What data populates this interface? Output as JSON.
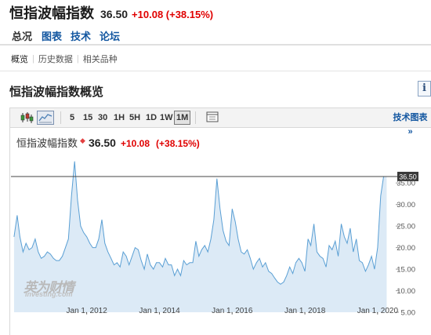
{
  "header": {
    "title": "恒指波幅指数",
    "price": "36.50",
    "change": "+10.08 (+38.15%)"
  },
  "main_tabs": [
    {
      "label": "总况",
      "active": true
    },
    {
      "label": "图表",
      "active": false
    },
    {
      "label": "技术",
      "active": false
    },
    {
      "label": "论坛",
      "active": false
    }
  ],
  "sub_tabs": [
    {
      "label": "概览",
      "active": true
    },
    {
      "label": "历史数据",
      "active": false
    },
    {
      "label": "相关品种",
      "active": false
    }
  ],
  "section": {
    "title": "恒指波幅指数概览",
    "info_icon": "i"
  },
  "toolbar": {
    "icons": [
      "candlestick-icon",
      "area-chart-icon"
    ],
    "intervals": [
      "5",
      "15",
      "30",
      "1H",
      "5H",
      "1D",
      "1W",
      "1M"
    ],
    "active_interval": "1M",
    "settings_icon": "settings-panel-icon",
    "tech_chart_label": "技术图表 »"
  },
  "legend": {
    "name": "恒指波幅指数",
    "price": "36.50",
    "change": "+10.08",
    "pct": "(+38.15%)",
    "dot_color": "#e34040"
  },
  "watermark": {
    "cn": "英为财情",
    "en": "Investing.com"
  },
  "chart_data": {
    "type": "area",
    "title": "",
    "xlabel": "",
    "ylabel": "",
    "y_ticks": [
      "5.00",
      "10.00",
      "15.00",
      "20.00",
      "25.00",
      "30.00",
      "35.00"
    ],
    "ylim": [
      5,
      42.5
    ],
    "x_ticks": [
      {
        "label": "Jan 1, 2012",
        "date": "2012-01-01"
      },
      {
        "label": "Jan 1, 2014",
        "date": "2014-01-01"
      },
      {
        "label": "Jan 1, 2016",
        "date": "2016-01-01"
      },
      {
        "label": "Jan 1, 2018",
        "date": "2018-01-01"
      },
      {
        "label": "Jan 1, 2020",
        "date": "2020-01-01"
      }
    ],
    "xlim": [
      "2009-12-01",
      "2020-07-01"
    ],
    "current_value": 36.5,
    "current_label": "36.50",
    "line_color": "#5a9fd4",
    "fill_color": "#dceaf6",
    "x": [
      "2010-01",
      "2010-02",
      "2010-03",
      "2010-04",
      "2010-05",
      "2010-06",
      "2010-07",
      "2010-08",
      "2010-09",
      "2010-10",
      "2010-11",
      "2010-12",
      "2011-01",
      "2011-02",
      "2011-03",
      "2011-04",
      "2011-05",
      "2011-06",
      "2011-07",
      "2011-08",
      "2011-09",
      "2011-10",
      "2011-11",
      "2011-12",
      "2012-01",
      "2012-02",
      "2012-03",
      "2012-04",
      "2012-05",
      "2012-06",
      "2012-07",
      "2012-08",
      "2012-09",
      "2012-10",
      "2012-11",
      "2012-12",
      "2013-01",
      "2013-02",
      "2013-03",
      "2013-04",
      "2013-05",
      "2013-06",
      "2013-07",
      "2013-08",
      "2013-09",
      "2013-10",
      "2013-11",
      "2013-12",
      "2014-01",
      "2014-02",
      "2014-03",
      "2014-04",
      "2014-05",
      "2014-06",
      "2014-07",
      "2014-08",
      "2014-09",
      "2014-10",
      "2014-11",
      "2014-12",
      "2015-01",
      "2015-02",
      "2015-03",
      "2015-04",
      "2015-05",
      "2015-06",
      "2015-07",
      "2015-08",
      "2015-09",
      "2015-10",
      "2015-11",
      "2015-12",
      "2016-01",
      "2016-02",
      "2016-03",
      "2016-04",
      "2016-05",
      "2016-06",
      "2016-07",
      "2016-08",
      "2016-09",
      "2016-10",
      "2016-11",
      "2016-12",
      "2017-01",
      "2017-02",
      "2017-03",
      "2017-04",
      "2017-05",
      "2017-06",
      "2017-07",
      "2017-08",
      "2017-09",
      "2017-10",
      "2017-11",
      "2017-12",
      "2018-01",
      "2018-02",
      "2018-03",
      "2018-04",
      "2018-05",
      "2018-06",
      "2018-07",
      "2018-08",
      "2018-09",
      "2018-10",
      "2018-11",
      "2018-12",
      "2019-01",
      "2019-02",
      "2019-03",
      "2019-04",
      "2019-05",
      "2019-06",
      "2019-07",
      "2019-08",
      "2019-09",
      "2019-10",
      "2019-11",
      "2019-12",
      "2020-01",
      "2020-02",
      "2020-03",
      "2020-04"
    ],
    "values": [
      22.5,
      27.5,
      22.5,
      19.0,
      21.0,
      19.5,
      20.0,
      22.0,
      19.0,
      17.5,
      18.0,
      19.0,
      18.5,
      17.5,
      17.0,
      17.0,
      18.0,
      20.0,
      22.0,
      32.0,
      40.0,
      31.0,
      25.0,
      23.5,
      22.5,
      21.0,
      20.0,
      20.0,
      22.0,
      26.5,
      21.0,
      19.0,
      17.5,
      16.0,
      16.5,
      15.5,
      19.0,
      18.0,
      16.0,
      18.0,
      20.0,
      19.5,
      17.0,
      15.0,
      18.5,
      16.0,
      15.0,
      16.5,
      16.5,
      15.5,
      17.5,
      16.0,
      16.0,
      13.5,
      15.0,
      13.5,
      17.0,
      16.0,
      16.5,
      16.5,
      21.5,
      18.0,
      19.5,
      20.5,
      19.0,
      22.0,
      26.5,
      36.0,
      29.0,
      24.0,
      21.5,
      20.5,
      29.0,
      26.0,
      22.0,
      19.0,
      18.5,
      19.5,
      17.5,
      15.0,
      16.5,
      17.5,
      15.5,
      16.5,
      14.5,
      14.0,
      13.0,
      12.0,
      11.5,
      12.0,
      13.5,
      15.5,
      14.0,
      16.5,
      17.5,
      16.5,
      14.5,
      22.0,
      20.5,
      25.5,
      19.0,
      18.0,
      17.5,
      15.5,
      20.5,
      19.5,
      21.5,
      18.0,
      25.5,
      22.5,
      21.0,
      24.5,
      19.0,
      22.0,
      17.0,
      16.5,
      14.5,
      16.0,
      18.0,
      15.0,
      20.0,
      32.0,
      36.5,
      36.5
    ]
  }
}
